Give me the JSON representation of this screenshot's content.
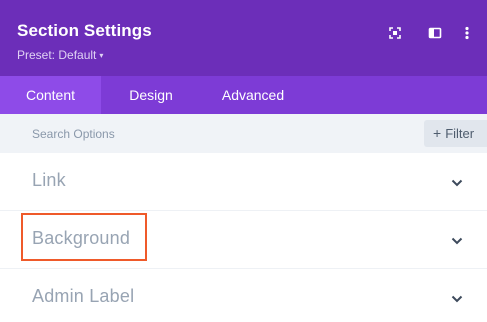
{
  "header": {
    "title": "Section Settings",
    "preset_label": "Preset: Default",
    "preset_caret": "▾",
    "icons": [
      "expand-icon",
      "split-view-icon",
      "more-options-icon"
    ]
  },
  "tabs": [
    {
      "label": "Content",
      "active": true
    },
    {
      "label": "Design",
      "active": false
    },
    {
      "label": "Advanced",
      "active": false
    }
  ],
  "search": {
    "placeholder": "Search Options",
    "value": "",
    "filter_label": "Filter",
    "filter_plus": "+"
  },
  "sections": [
    {
      "label": "Link",
      "icon": "chevron-down-icon"
    },
    {
      "label": "Background",
      "icon": "chevron-down-icon"
    },
    {
      "label": "Admin Label",
      "icon": "chevron-down-icon"
    }
  ],
  "colors": {
    "header_bg": "#6c2eb9",
    "tabs_bg": "#7d3bd6",
    "active_tab_bg": "#8e4be8",
    "search_bg": "#f0f3f7",
    "section_text": "#98a4b3",
    "highlight_border": "#ef5a2a"
  }
}
